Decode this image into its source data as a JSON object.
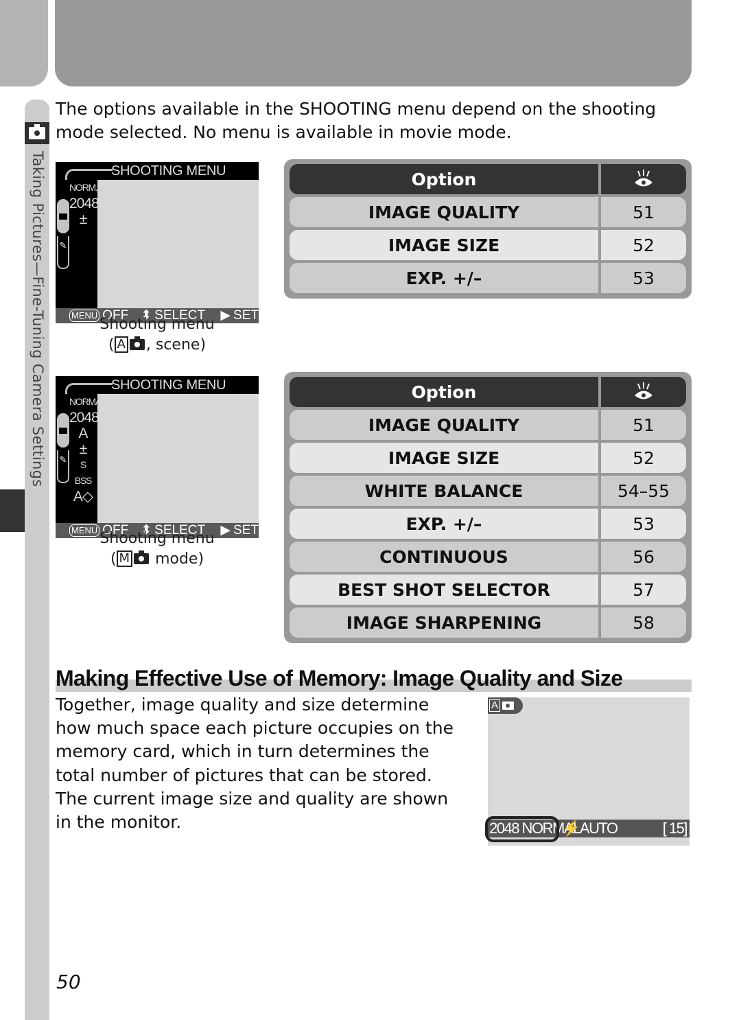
{
  "side_tab": {
    "section_label": "Taking Pictures—Fine-Tuning Camera Settings",
    "icon": "camera-icon"
  },
  "intro": {
    "text": "The options available in the SHOOTING menu depend on the shooting mode selected.  No menu is available in movie mode."
  },
  "screens": [
    {
      "title": "SHOOTING MENU",
      "side_icons": [
        "NORM.",
        "2048",
        "±"
      ],
      "footer": {
        "menu_key": "MENU",
        "off": "OFF",
        "select": "SELECT",
        "set": "SET"
      },
      "caption_line1": "Shooting menu",
      "caption_mode_letter": "A",
      "caption_suffix": ", scene)"
    },
    {
      "title": "SHOOTING MENU",
      "side_icons": [
        "NORMAL",
        "2048",
        "A",
        "±",
        "S",
        "BSS",
        "A◇"
      ],
      "footer": {
        "menu_key": "MENU",
        "off": "OFF",
        "select": "SELECT",
        "set": "SET"
      },
      "caption_line1": "Shooting menu",
      "caption_mode_letter": "M",
      "caption_suffix": " mode)"
    }
  ],
  "tables": [
    {
      "header": {
        "option": "Option",
        "page_icon": "eye-reference-icon"
      },
      "rows": [
        {
          "option": "IMAGE QUALITY",
          "page": "51"
        },
        {
          "option": "IMAGE SIZE",
          "page": "52"
        },
        {
          "option": "EXP. +/–",
          "page": "53"
        }
      ]
    },
    {
      "header": {
        "option": "Option",
        "page_icon": "eye-reference-icon"
      },
      "rows": [
        {
          "option": "IMAGE QUALITY",
          "page": "51"
        },
        {
          "option": "IMAGE SIZE",
          "page": "52"
        },
        {
          "option": "WHITE BALANCE",
          "page": "54–55"
        },
        {
          "option": "EXP. +/–",
          "page": "53"
        },
        {
          "option": "CONTINUOUS",
          "page": "56"
        },
        {
          "option": "BEST SHOT SELECTOR",
          "page": "57"
        },
        {
          "option": "IMAGE SHARPENING",
          "page": "58"
        }
      ]
    }
  ],
  "section": {
    "title": "Making Effective Use of Memory: Image Quality and Size",
    "body": "Together, image quality and size determine how much space each picture occupies on the memory card, which in turn determines the total number of pictures that can be stored.  The current image size and quality are shown in the monitor."
  },
  "monitor": {
    "mode_letter": "A",
    "size_quality": "2048 NORMAL",
    "flash": "⚡AUTO",
    "frames": "[   15]"
  },
  "page_number": "50",
  "colors": {
    "header_gray": "#999999",
    "table_head": "#333333",
    "row_dark": "#cccccc",
    "row_light": "#e6e6e6"
  }
}
